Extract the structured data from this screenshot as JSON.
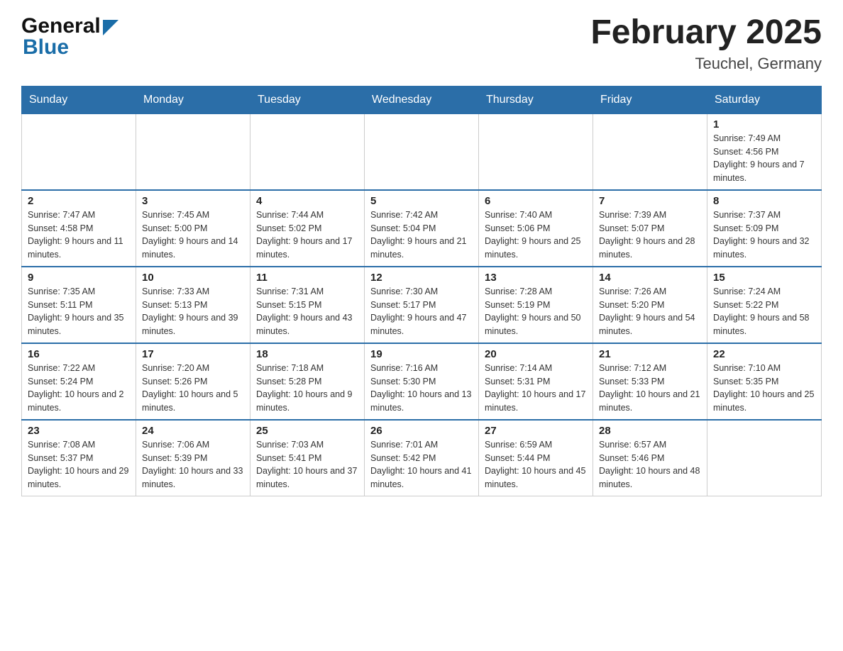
{
  "header": {
    "logo_text_general": "General",
    "logo_text_blue": "Blue",
    "title": "February 2025",
    "location": "Teuchel, Germany"
  },
  "calendar": {
    "days_of_week": [
      "Sunday",
      "Monday",
      "Tuesday",
      "Wednesday",
      "Thursday",
      "Friday",
      "Saturday"
    ],
    "weeks": [
      {
        "days": [
          {
            "number": "",
            "info": "",
            "empty": true
          },
          {
            "number": "",
            "info": "",
            "empty": true
          },
          {
            "number": "",
            "info": "",
            "empty": true
          },
          {
            "number": "",
            "info": "",
            "empty": true
          },
          {
            "number": "",
            "info": "",
            "empty": true
          },
          {
            "number": "",
            "info": "",
            "empty": true
          },
          {
            "number": "1",
            "info": "Sunrise: 7:49 AM\nSunset: 4:56 PM\nDaylight: 9 hours and 7 minutes.",
            "empty": false
          }
        ]
      },
      {
        "days": [
          {
            "number": "2",
            "info": "Sunrise: 7:47 AM\nSunset: 4:58 PM\nDaylight: 9 hours and 11 minutes.",
            "empty": false
          },
          {
            "number": "3",
            "info": "Sunrise: 7:45 AM\nSunset: 5:00 PM\nDaylight: 9 hours and 14 minutes.",
            "empty": false
          },
          {
            "number": "4",
            "info": "Sunrise: 7:44 AM\nSunset: 5:02 PM\nDaylight: 9 hours and 17 minutes.",
            "empty": false
          },
          {
            "number": "5",
            "info": "Sunrise: 7:42 AM\nSunset: 5:04 PM\nDaylight: 9 hours and 21 minutes.",
            "empty": false
          },
          {
            "number": "6",
            "info": "Sunrise: 7:40 AM\nSunset: 5:06 PM\nDaylight: 9 hours and 25 minutes.",
            "empty": false
          },
          {
            "number": "7",
            "info": "Sunrise: 7:39 AM\nSunset: 5:07 PM\nDaylight: 9 hours and 28 minutes.",
            "empty": false
          },
          {
            "number": "8",
            "info": "Sunrise: 7:37 AM\nSunset: 5:09 PM\nDaylight: 9 hours and 32 minutes.",
            "empty": false
          }
        ]
      },
      {
        "days": [
          {
            "number": "9",
            "info": "Sunrise: 7:35 AM\nSunset: 5:11 PM\nDaylight: 9 hours and 35 minutes.",
            "empty": false
          },
          {
            "number": "10",
            "info": "Sunrise: 7:33 AM\nSunset: 5:13 PM\nDaylight: 9 hours and 39 minutes.",
            "empty": false
          },
          {
            "number": "11",
            "info": "Sunrise: 7:31 AM\nSunset: 5:15 PM\nDaylight: 9 hours and 43 minutes.",
            "empty": false
          },
          {
            "number": "12",
            "info": "Sunrise: 7:30 AM\nSunset: 5:17 PM\nDaylight: 9 hours and 47 minutes.",
            "empty": false
          },
          {
            "number": "13",
            "info": "Sunrise: 7:28 AM\nSunset: 5:19 PM\nDaylight: 9 hours and 50 minutes.",
            "empty": false
          },
          {
            "number": "14",
            "info": "Sunrise: 7:26 AM\nSunset: 5:20 PM\nDaylight: 9 hours and 54 minutes.",
            "empty": false
          },
          {
            "number": "15",
            "info": "Sunrise: 7:24 AM\nSunset: 5:22 PM\nDaylight: 9 hours and 58 minutes.",
            "empty": false
          }
        ]
      },
      {
        "days": [
          {
            "number": "16",
            "info": "Sunrise: 7:22 AM\nSunset: 5:24 PM\nDaylight: 10 hours and 2 minutes.",
            "empty": false
          },
          {
            "number": "17",
            "info": "Sunrise: 7:20 AM\nSunset: 5:26 PM\nDaylight: 10 hours and 5 minutes.",
            "empty": false
          },
          {
            "number": "18",
            "info": "Sunrise: 7:18 AM\nSunset: 5:28 PM\nDaylight: 10 hours and 9 minutes.",
            "empty": false
          },
          {
            "number": "19",
            "info": "Sunrise: 7:16 AM\nSunset: 5:30 PM\nDaylight: 10 hours and 13 minutes.",
            "empty": false
          },
          {
            "number": "20",
            "info": "Sunrise: 7:14 AM\nSunset: 5:31 PM\nDaylight: 10 hours and 17 minutes.",
            "empty": false
          },
          {
            "number": "21",
            "info": "Sunrise: 7:12 AM\nSunset: 5:33 PM\nDaylight: 10 hours and 21 minutes.",
            "empty": false
          },
          {
            "number": "22",
            "info": "Sunrise: 7:10 AM\nSunset: 5:35 PM\nDaylight: 10 hours and 25 minutes.",
            "empty": false
          }
        ]
      },
      {
        "days": [
          {
            "number": "23",
            "info": "Sunrise: 7:08 AM\nSunset: 5:37 PM\nDaylight: 10 hours and 29 minutes.",
            "empty": false
          },
          {
            "number": "24",
            "info": "Sunrise: 7:06 AM\nSunset: 5:39 PM\nDaylight: 10 hours and 33 minutes.",
            "empty": false
          },
          {
            "number": "25",
            "info": "Sunrise: 7:03 AM\nSunset: 5:41 PM\nDaylight: 10 hours and 37 minutes.",
            "empty": false
          },
          {
            "number": "26",
            "info": "Sunrise: 7:01 AM\nSunset: 5:42 PM\nDaylight: 10 hours and 41 minutes.",
            "empty": false
          },
          {
            "number": "27",
            "info": "Sunrise: 6:59 AM\nSunset: 5:44 PM\nDaylight: 10 hours and 45 minutes.",
            "empty": false
          },
          {
            "number": "28",
            "info": "Sunrise: 6:57 AM\nSunset: 5:46 PM\nDaylight: 10 hours and 48 minutes.",
            "empty": false
          },
          {
            "number": "",
            "info": "",
            "empty": true
          }
        ]
      }
    ]
  }
}
